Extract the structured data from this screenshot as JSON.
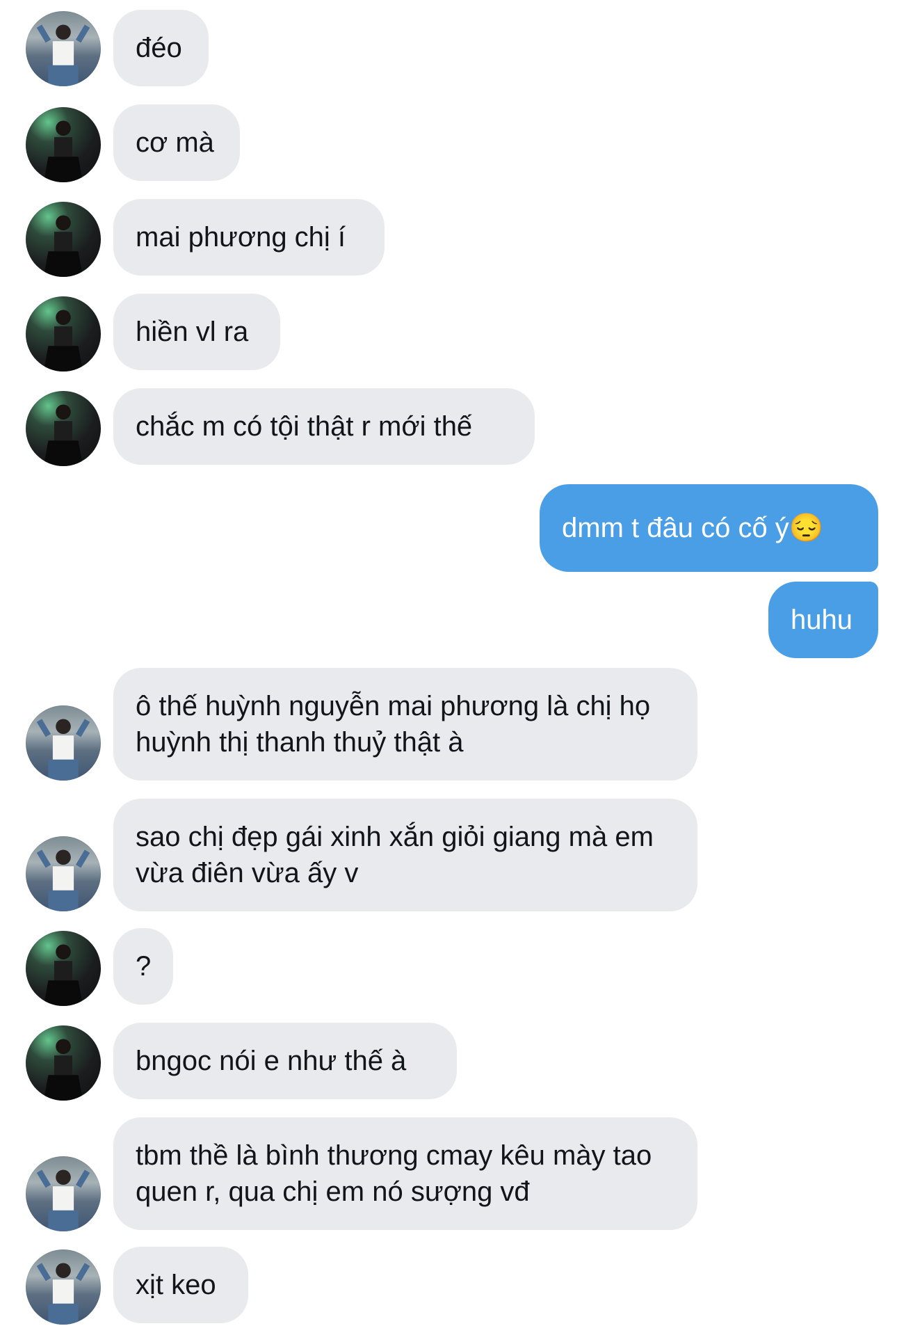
{
  "messages": [
    {
      "from": "friend",
      "avatar": "denim",
      "text": "đéo"
    },
    {
      "from": "friend",
      "avatar": "night",
      "text": "cơ mà"
    },
    {
      "from": "friend",
      "avatar": "night",
      "text": "mai phương chị í"
    },
    {
      "from": "friend",
      "avatar": "night",
      "text": "hiền vl ra"
    },
    {
      "from": "friend",
      "avatar": "night",
      "text": "chắc m có tội thật r mới thế"
    },
    {
      "from": "me",
      "text": "dmm t đâu có cố ý😔"
    },
    {
      "from": "me",
      "text": "huhu"
    },
    {
      "from": "friend",
      "avatar": "denim",
      "text": "ô thế huỳnh nguyễn mai phương là chị họ huỳnh thị thanh thuỷ thật à"
    },
    {
      "from": "friend",
      "avatar": "denim",
      "text": "sao chị đẹp gái xinh xắn giỏi giang mà em vừa điên vừa ấy v"
    },
    {
      "from": "friend",
      "avatar": "night",
      "text": "?"
    },
    {
      "from": "friend",
      "avatar": "night",
      "text": "bngoc nói e như thế à"
    },
    {
      "from": "friend",
      "avatar": "denim",
      "text": "tbm thề là bình thương cmay kêu mày tao quen r, qua chị em nó sượng vđ"
    },
    {
      "from": "friend",
      "avatar": "denim",
      "text": "xịt keo"
    }
  ],
  "colors": {
    "incoming_bubble": "#e9eaee",
    "outgoing_bubble": "#4a9ee6"
  }
}
